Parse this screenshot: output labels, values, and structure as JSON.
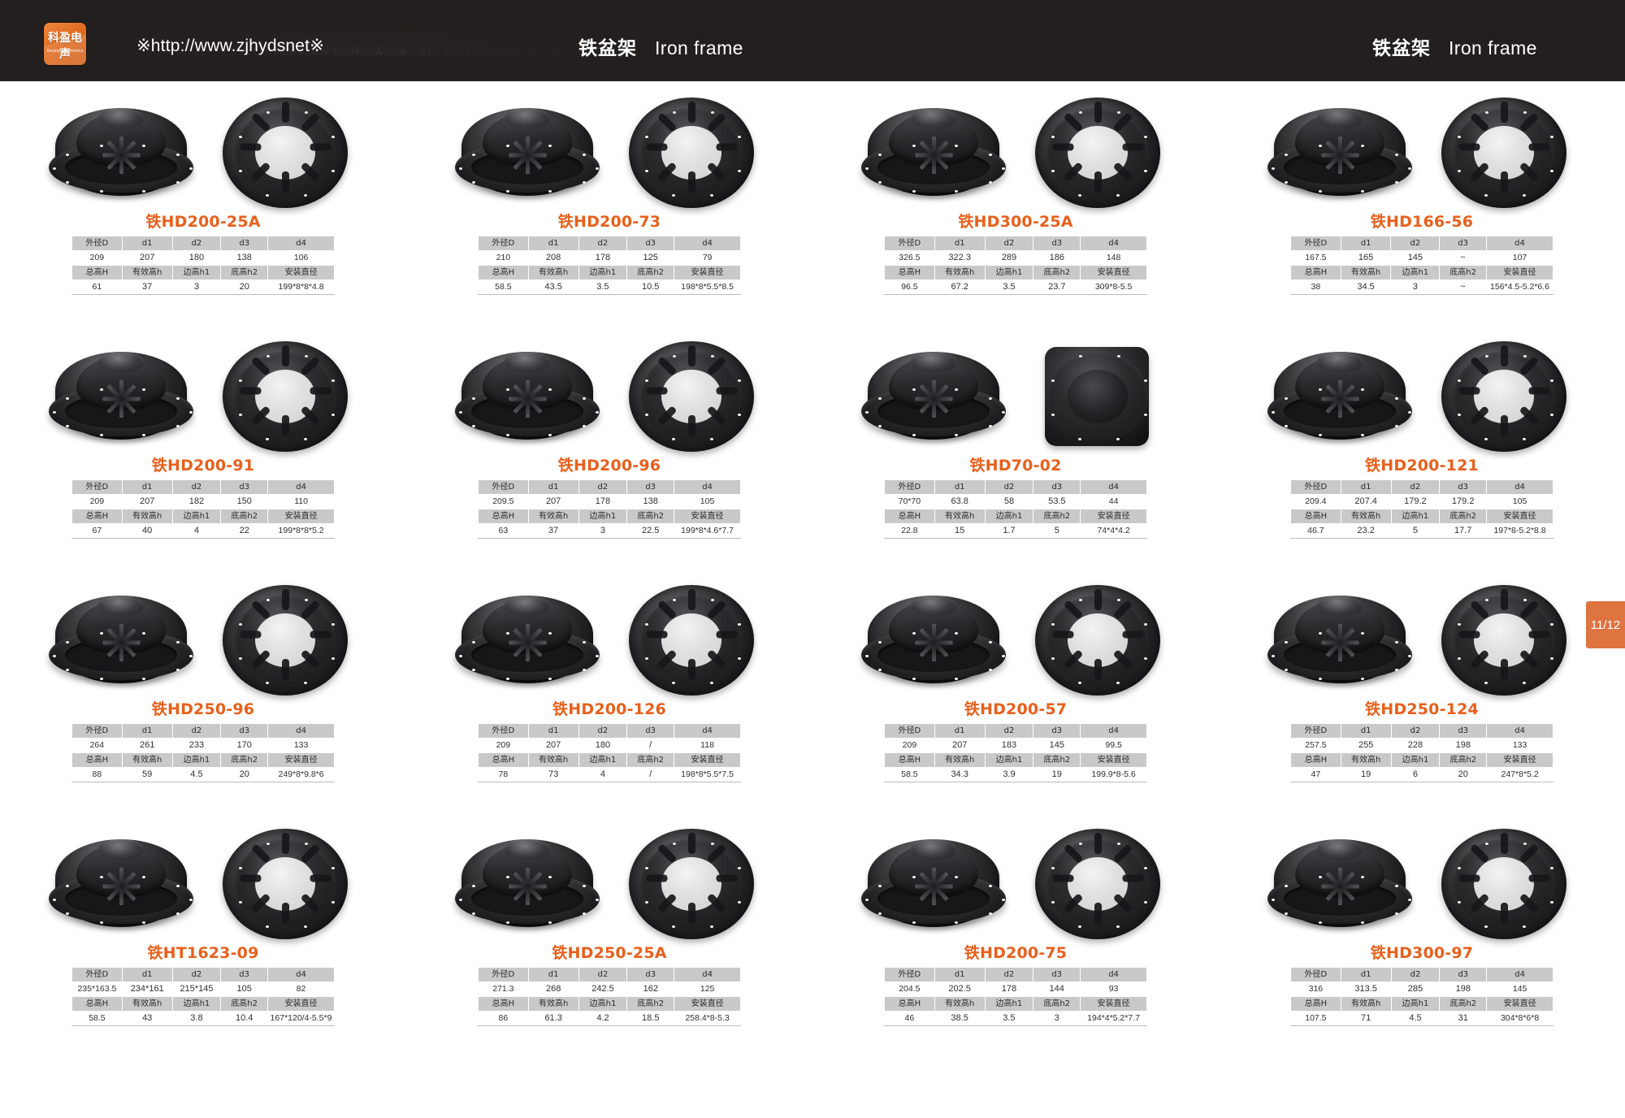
{
  "header": {
    "logo_cn": "科盈电声",
    "logo_en": "Keying Electronics",
    "url": "※http://www.zjhydsnet※",
    "title_cn": "铁盆架",
    "title_en": "Iron frame",
    "title_cn_right": "铁盆架",
    "title_en_right": "Iron frame",
    "accent_color": "#e8601c",
    "bar_color": "#231f1e"
  },
  "page_badge": "11/12",
  "table_headers": {
    "row1": [
      "外径D",
      "d1",
      "d2",
      "d3",
      "d4"
    ],
    "row2": [
      "总高H",
      "有效高h",
      "边高h1",
      "底高h2",
      "安装直径"
    ]
  },
  "products": [
    {
      "model": "铁HD200-25A",
      "dims": [
        "209",
        "207",
        "180",
        "138",
        "106"
      ],
      "heights": [
        "61",
        "37",
        "3",
        "20",
        "199*8*8*4.8"
      ],
      "left_view": "perspective",
      "right_view": "face"
    },
    {
      "model": "铁HD200-73",
      "dims": [
        "210",
        "208",
        "178",
        "125",
        "79"
      ],
      "heights": [
        "58.5",
        "43.5",
        "3.5",
        "10.5",
        "198*8*5.5*8.5"
      ],
      "left_view": "perspective",
      "right_view": "face"
    },
    {
      "model": "铁HD300-25A",
      "dims": [
        "326.5",
        "322.3",
        "289",
        "186",
        "148"
      ],
      "heights": [
        "96.5",
        "67.2",
        "3.5",
        "23.7",
        "309*8-5.5"
      ],
      "left_view": "perspective",
      "right_view": "face"
    },
    {
      "model": "铁HD166-56",
      "dims": [
        "167.5",
        "165",
        "145",
        "~",
        "107"
      ],
      "heights": [
        "38",
        "34.5",
        "3",
        "~",
        "156*4.5-5.2*6.6"
      ],
      "left_view": "perspective",
      "right_view": "face"
    },
    {
      "model": "铁HD200-91",
      "dims": [
        "209",
        "207",
        "182",
        "150",
        "110"
      ],
      "heights": [
        "67",
        "40",
        "4",
        "22",
        "199*8*8*5.2"
      ],
      "left_view": "perspective",
      "right_view": "face"
    },
    {
      "model": "铁HD200-96",
      "dims": [
        "209.5",
        "207",
        "178",
        "138",
        "105"
      ],
      "heights": [
        "63",
        "37",
        "3",
        "22.5",
        "199*8*4.6*7.7"
      ],
      "left_view": "perspective",
      "right_view": "face"
    },
    {
      "model": "铁HD70-02",
      "dims": [
        "70*70",
        "63.8",
        "58",
        "53.5",
        "44"
      ],
      "heights": [
        "22.8",
        "15",
        "1.7",
        "5",
        "74*4*4.2"
      ],
      "left_view": "perspective",
      "right_view": "square"
    },
    {
      "model": "铁HD200-121",
      "dims": [
        "209.4",
        "207.4",
        "179.2",
        "179.2",
        "105"
      ],
      "heights": [
        "46.7",
        "23.2",
        "5",
        "17.7",
        "197*8-5.2*8.8"
      ],
      "left_view": "perspective",
      "right_view": "face"
    },
    {
      "model": "铁HD250-96",
      "dims": [
        "264",
        "261",
        "233",
        "170",
        "133"
      ],
      "heights": [
        "88",
        "59",
        "4.5",
        "20",
        "249*8*9.8*6"
      ],
      "left_view": "perspective",
      "right_view": "face"
    },
    {
      "model": "铁HD200-126",
      "dims": [
        "209",
        "207",
        "180",
        "/",
        "118"
      ],
      "heights": [
        "78",
        "73",
        "4",
        "/",
        "198*8*5.5*7.5"
      ],
      "left_view": "perspective",
      "right_view": "face"
    },
    {
      "model": "铁HD200-57",
      "dims": [
        "209",
        "207",
        "183",
        "145",
        "99.5"
      ],
      "heights": [
        "58.5",
        "34.3",
        "3.9",
        "19",
        "199.9*8-5.6"
      ],
      "left_view": "perspective",
      "right_view": "face"
    },
    {
      "model": "铁HD250-124",
      "dims": [
        "257.5",
        "255",
        "228",
        "198",
        "133"
      ],
      "heights": [
        "47",
        "19",
        "6",
        "20",
        "247*8*5.2"
      ],
      "left_view": "perspective",
      "right_view": "face"
    },
    {
      "model": "铁HT1623-09",
      "dims": [
        "235*163.5",
        "234*161",
        "215*145",
        "105",
        "82"
      ],
      "heights": [
        "58.5",
        "43",
        "3.8",
        "10.4",
        "167*120/4-5.5*9"
      ],
      "left_view": "perspective",
      "right_view": "face"
    },
    {
      "model": "铁HD250-25A",
      "dims": [
        "271.3",
        "268",
        "242.5",
        "162",
        "125"
      ],
      "heights": [
        "86",
        "61.3",
        "4.2",
        "18.5",
        "258.4*8-5.3"
      ],
      "left_view": "perspective",
      "right_view": "face"
    },
    {
      "model": "铁HD200-75",
      "dims": [
        "204.5",
        "202.5",
        "178",
        "144",
        "93"
      ],
      "heights": [
        "46",
        "38.5",
        "3.5",
        "3",
        "194*4*5.2*7.7"
      ],
      "left_view": "perspective",
      "right_view": "face"
    },
    {
      "model": "铁HD300-97",
      "dims": [
        "316",
        "313.5",
        "285",
        "198",
        "145"
      ],
      "heights": [
        "107.5",
        "71",
        "4.5",
        "31",
        "304*8*6*8"
      ],
      "left_view": "perspective",
      "right_view": "face"
    }
  ]
}
